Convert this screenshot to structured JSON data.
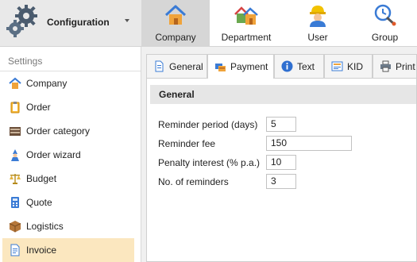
{
  "header": {
    "title": "Configuration",
    "icon": "gears-icon"
  },
  "ribbon": {
    "buttons": [
      {
        "label": "Company",
        "icon": "house-icon",
        "active": true
      },
      {
        "label": "Department",
        "icon": "houses-icon",
        "active": false
      },
      {
        "label": "User",
        "icon": "worker-icon",
        "active": false
      },
      {
        "label": "Group",
        "icon": "group-tools-icon",
        "active": false
      }
    ]
  },
  "sidebar": {
    "title": "Settings",
    "items": [
      {
        "label": "Company",
        "icon": "house-icon"
      },
      {
        "label": "Order",
        "icon": "clipboard-icon"
      },
      {
        "label": "Order category",
        "icon": "category-icon"
      },
      {
        "label": "Order wizard",
        "icon": "wizard-icon"
      },
      {
        "label": "Budget",
        "icon": "scales-icon"
      },
      {
        "label": "Quote",
        "icon": "calculator-icon"
      },
      {
        "label": "Logistics",
        "icon": "box-icon"
      },
      {
        "label": "Invoice",
        "icon": "invoice-icon",
        "selected": true
      }
    ]
  },
  "tabs": [
    {
      "label": "General",
      "icon": "document-icon"
    },
    {
      "label": "Payment",
      "icon": "payment-icon",
      "active": true
    },
    {
      "label": "Text",
      "icon": "info-icon"
    },
    {
      "label": "KID",
      "icon": "kid-icon"
    },
    {
      "label": "Print",
      "icon": "printer-icon"
    }
  ],
  "form": {
    "group_title": "General",
    "fields": [
      {
        "label": "Reminder period (days)",
        "value": "5"
      },
      {
        "label": "Reminder fee",
        "value": "150"
      },
      {
        "label": "Penalty interest (% p.a.)",
        "value": "10"
      },
      {
        "label": "No. of reminders",
        "value": "3"
      }
    ]
  }
}
